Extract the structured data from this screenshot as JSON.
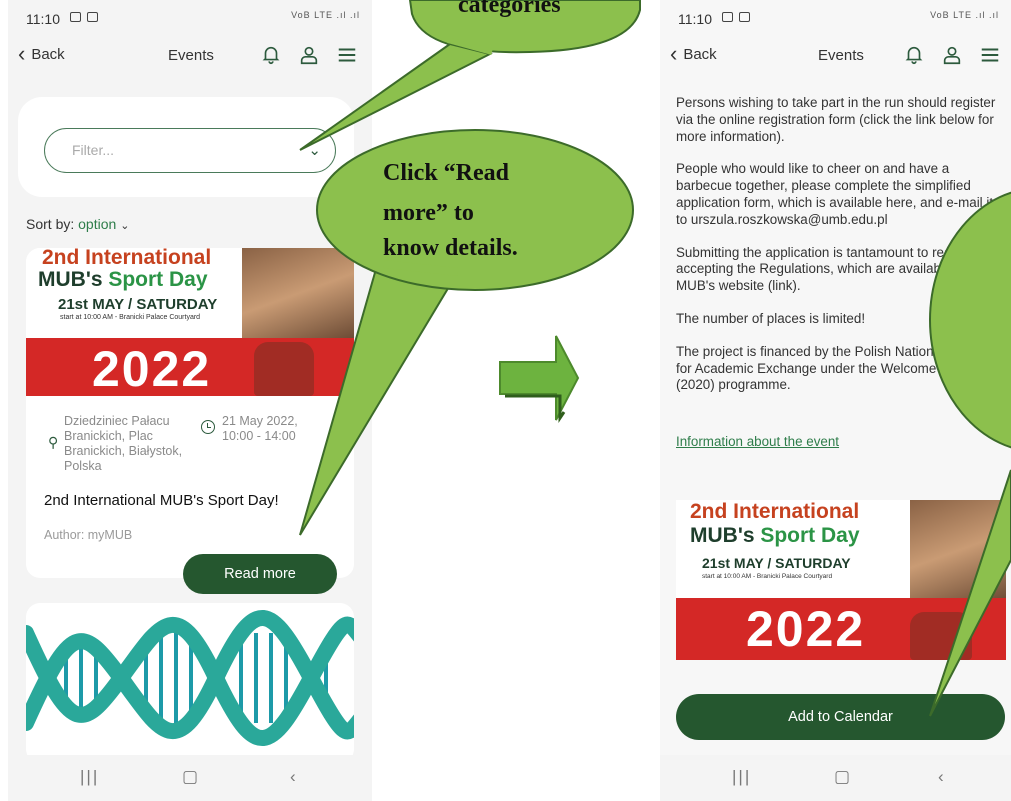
{
  "left_screen": {
    "status_time": "11:10",
    "status_network": "VoB LTE .ıl .ıl",
    "back_label": "Back",
    "title": "Events",
    "filter_placeholder": "Filter...",
    "sort_label": "Sort by:",
    "sort_option": "option",
    "event": {
      "banner_line1": "2nd International",
      "banner_line2a": "MUB's ",
      "banner_line2b": "Sport Day",
      "banner_date": "21st MAY / SATURDAY",
      "banner_sub": "start at 10:00 AM - Branicki Palace Courtyard",
      "banner_year": "2022",
      "location": "Dziedziniec Pałacu Branickich, Plac Branickich, Białystok, Polska",
      "datetime": "21 May 2022, 10:00 - 14:00",
      "title": "2nd International MUB's Sport Day!",
      "author": "Author: myMUB",
      "read_more": "Read more"
    }
  },
  "right_screen": {
    "status_time": "11:10",
    "status_network": "VoB LTE .ıl .ıl",
    "back_label": "Back",
    "title": "Events",
    "paragraphs": [
      "Persons wishing to take part in the run should register via the online registration form (click the link below for more information).",
      "People who would like to cheer on and have a barbecue together, please complete the simplified application form, which is available here, and e-mail it to urszula.roszkowska@umb.edu.pl",
      "Submitting the application is tantamount to reading and accepting the Regulations, which are available on the MUB's website (link).",
      "The number of places is limited!",
      "The project is financed by the Polish National Agency for Academic Exchange under the Welcome to Poland (2020) programme."
    ],
    "info_link": "Information about the event",
    "banner_line1": "2nd International",
    "banner_line2a": "MUB's ",
    "banner_line2b": "Sport Day",
    "banner_date": "21st MAY / SATURDAY",
    "banner_sub": "start at 10:00 AM - Branicki Palace Courtyard",
    "banner_year": "2022",
    "add_calendar": "Add to Calendar"
  },
  "annotations": {
    "callout_top": "categories",
    "callout_middle_1": "Click “Read",
    "callout_middle_2": "more” to",
    "callout_middle_3": "know details."
  },
  "colors": {
    "primary_green": "#25572f",
    "callout_green": "#8cc04d",
    "callout_border": "#3c6b2a",
    "link_green": "#2e7d4a"
  }
}
